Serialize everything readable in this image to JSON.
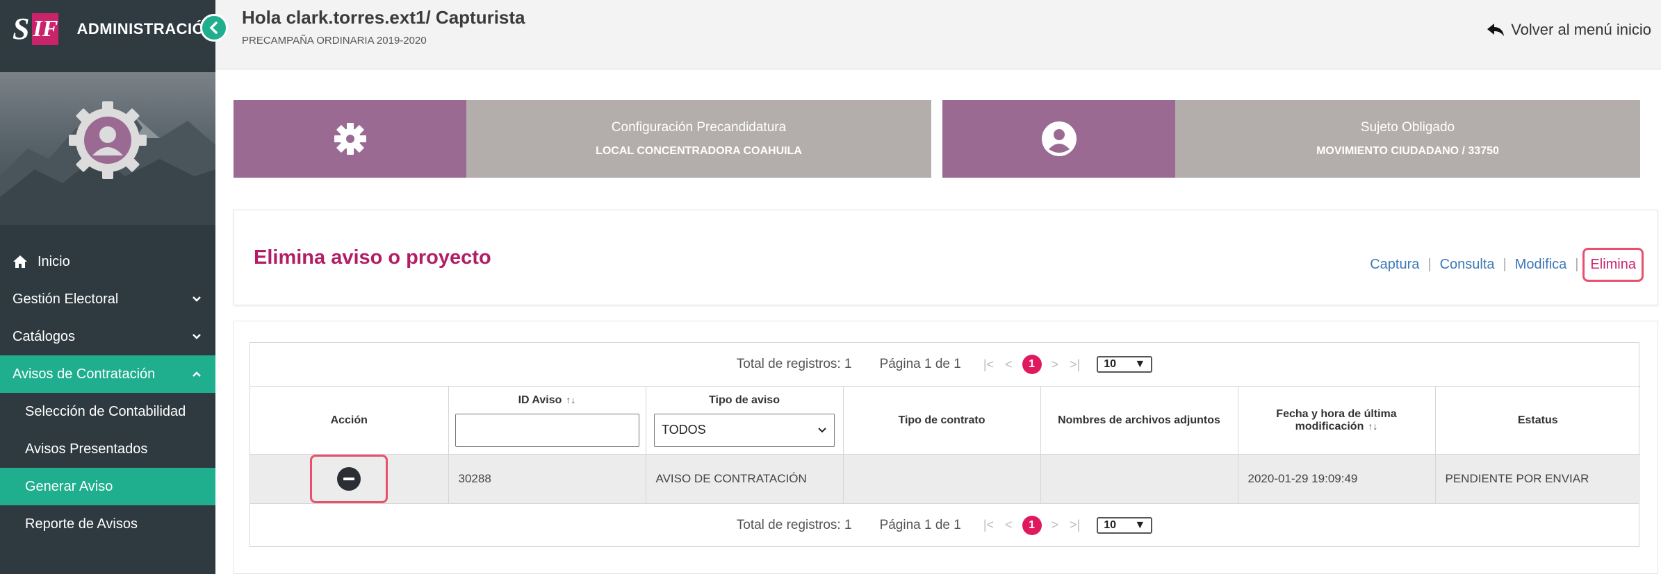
{
  "brand": {
    "logo_s": "S",
    "logo_if": "IF",
    "admin_title": "ADMINISTRACIÓN"
  },
  "header": {
    "greeting": "Hola clark.torres.ext1/ Capturista",
    "subtitle": "PRECAMPAÑA ORDINARIA 2019-2020",
    "back_link": "Volver al menú inicio"
  },
  "sidebar": {
    "items": [
      {
        "label": "Inicio",
        "icon": "home-icon"
      },
      {
        "label": "Gestión Electoral",
        "icon": "chevron-down-icon"
      },
      {
        "label": "Catálogos",
        "icon": "chevron-down-icon"
      },
      {
        "label": "Avisos de Contratación",
        "icon": "chevron-up-icon",
        "expanded": true
      }
    ],
    "subitems": [
      {
        "label": "Selección de Contabilidad"
      },
      {
        "label": "Avisos Presentados"
      },
      {
        "label": "Generar Aviso",
        "current": true
      },
      {
        "label": "Reporte de Avisos"
      }
    ]
  },
  "cards": {
    "config": {
      "title": "Configuración Precandidatura",
      "value": "LOCAL CONCENTRADORA COAHUILA",
      "icon": "gear-icon"
    },
    "subject": {
      "title": "Sujeto Obligado",
      "value": "MOVIMIENTO CIUDADANO / 33750",
      "icon": "user-circle-icon"
    }
  },
  "page": {
    "title": "Elimina aviso o proyecto",
    "tabs": [
      "Captura",
      "Consulta",
      "Modifica",
      "Elimina"
    ],
    "active_tab": "Elimina"
  },
  "pager": {
    "total_label": "Total de registros: 1",
    "page_label": "Página 1 de 1",
    "current_page": "1",
    "page_size": "10"
  },
  "table": {
    "columns": [
      "Acción",
      "ID Aviso",
      "Tipo de aviso",
      "Tipo de contrato",
      "Nombres de archivos adjuntos",
      "Fecha y hora de última modificación",
      "Estatus"
    ],
    "filter_select_value": "TODOS",
    "rows": [
      {
        "id": "30288",
        "tipo_aviso": "AVISO DE CONTRATACIÓN",
        "tipo_contrato": "",
        "archivos": "",
        "fecha": "2020-01-29 19:09:49",
        "estatus": "PENDIENTE POR ENVIAR"
      }
    ]
  },
  "colors": {
    "accent_green": "#1fae8e",
    "brand_magenta": "#c9246b",
    "card_purple": "#9a6a93",
    "card_gray": "#b3aeab",
    "sidebar_bg": "#2e3a40"
  }
}
